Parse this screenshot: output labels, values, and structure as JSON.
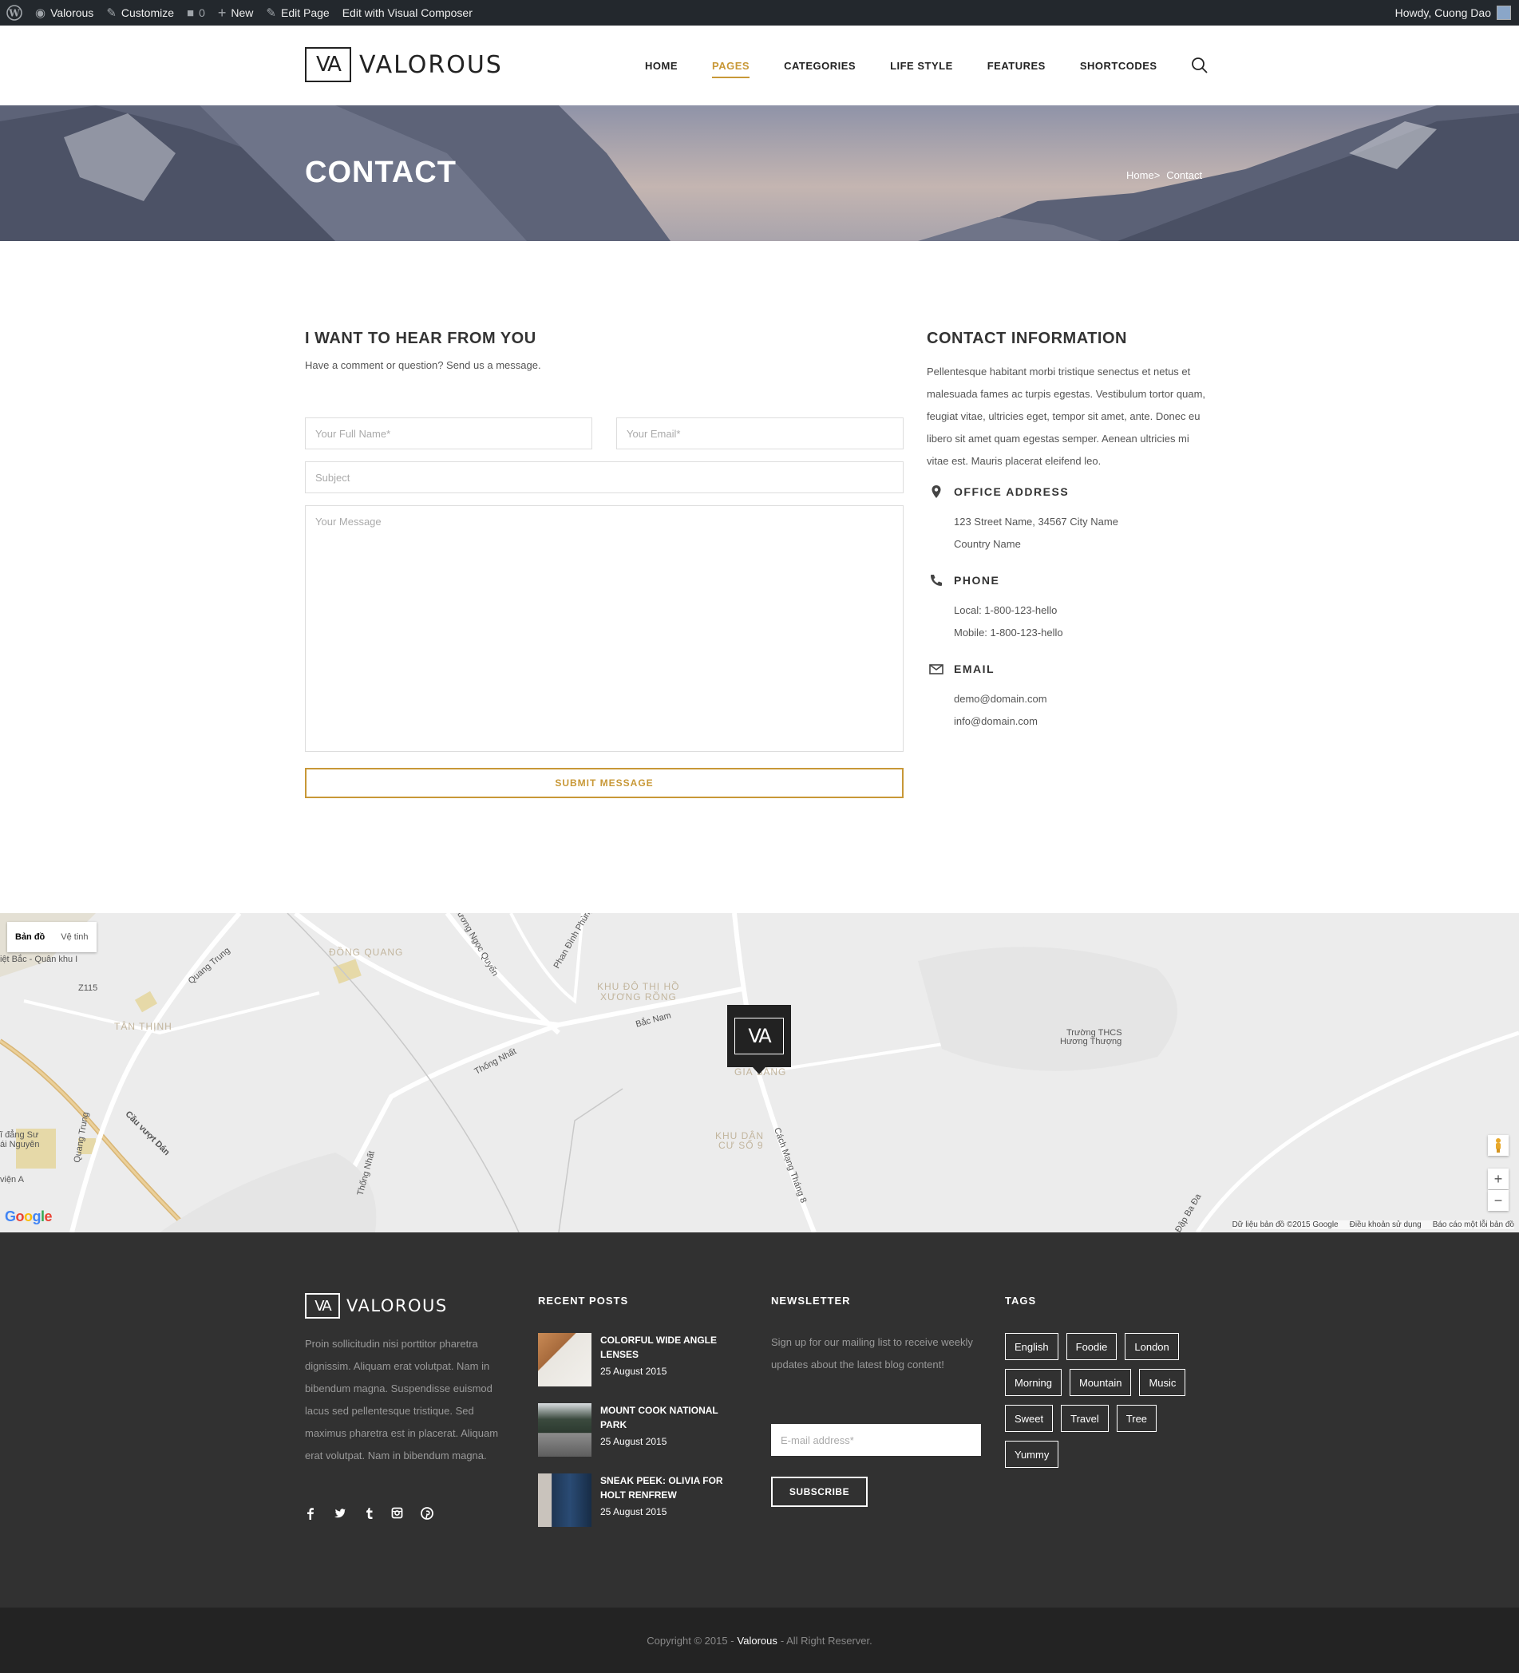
{
  "admin_bar": {
    "site": "Valorous",
    "customize": "Customize",
    "comments": "0",
    "new": "New",
    "edit_page": "Edit Page",
    "visual_composer": "Edit with Visual Composer",
    "howdy": "Howdy, Cuong Dao"
  },
  "header": {
    "logo_mark": "VA",
    "logo_text": "VALOROUS",
    "nav": [
      "HOME",
      "PAGES",
      "CATEGORIES",
      "LIFE STYLE",
      "FEATURES",
      "SHORTCODES"
    ],
    "active_nav": "PAGES"
  },
  "hero": {
    "title": "CONTACT",
    "breadcrumb": [
      "Home",
      ">",
      "Contact"
    ]
  },
  "form": {
    "title": "I WANT TO HEAR FROM YOU",
    "subtitle": "Have a comment or question? Send us a message.",
    "name_placeholder": "Your Full Name*",
    "email_placeholder": "Your Email*",
    "subject_placeholder": "Subject",
    "message_placeholder": "Your Message",
    "submit": "SUBMIT MESSAGE"
  },
  "contact_info": {
    "title": "CONTACT INFORMATION",
    "text": "Pellentesque habitant morbi tristique senectus et netus et malesuada fames ac turpis egestas. Vestibulum tortor quam, feugiat vitae, ultricies eget, tempor sit amet, ante. Donec eu libero sit amet quam egestas semper. Aenean ultricies mi vitae est. Mauris placerat eleifend leo.",
    "office_title": "OFFICE ADDRESS",
    "office_lines": [
      "123 Street Name, 34567 City Name",
      "Country Name"
    ],
    "phone_title": "PHONE",
    "phone_lines": [
      "Local: 1-800-123-hello",
      "Mobile: 1-800-123-hello"
    ],
    "email_title": "EMAIL",
    "email_lines": [
      "demo@domain.com",
      "info@domain.com"
    ]
  },
  "map": {
    "map_type": "Bản đồ",
    "satellite": "Vệ tinh",
    "labels": {
      "dong_quang": "ĐỒNG QUANG",
      "tan_thinh": "TÂN THỊNH",
      "khu_do_thi": "KHU ĐÔ THỊ HỒ",
      "xuong_rong": "XƯƠNG RỒNG",
      "khu_dan": "KHU DÂN",
      "cu_so": "CƯ SỐ 9",
      "gia_sang": "GIA SÀNG",
      "quang_trung": "Quang Trung",
      "bac_nam": "Bắc Nam",
      "thong_nhat": "Thống Nhất",
      "thong_nhat2": "Thống Nhất",
      "cau_vuot": "Cầu vượt Dán",
      "z115": "Z115",
      "phan_dinh_phung": "Phan Đình Phùng",
      "luong_ngoc_quyen": "Lương Ngọc Quyến",
      "cach_mang": "Cách Mạng Tháng 8",
      "quan_khu": "iệt Bắc - Quân khu I",
      "school1": "Trường THCS",
      "school2": "Hương Thượng",
      "dang_su": "ĩ đẳng Sư",
      "nguyen": "ái Nguyên",
      "vien_a": "viện A",
      "ap_ba_da": "Đập Ba Đa"
    },
    "google": "Google",
    "footer_links": [
      "Dữ liệu bản đồ ©2015 Google",
      "Điều khoản sử dụng",
      "Báo cáo một lỗi bản đồ"
    ]
  },
  "footer": {
    "logo_mark": "VA",
    "logo_text": "VALOROUS",
    "about": "Proin sollicitudin nisi porttitor pharetra dignissim. Aliquam erat volutpat. Nam in bibendum magna. Suspendisse euismod lacus sed pellentesque tristique. Sed maximus pharetra est in placerat. Aliquam erat volutpat. Nam in bibendum magna.",
    "social_icons": [
      "facebook-icon",
      "twitter-icon",
      "tumblr-icon",
      "instagram-icon",
      "pinterest-icon"
    ],
    "recent_title": "RECENT POSTS",
    "posts": [
      {
        "title": "COLORFUL WIDE ANGLE LENSES",
        "date": "25 August 2015"
      },
      {
        "title": "MOUNT COOK NATIONAL PARK",
        "date": "25 August 2015"
      },
      {
        "title": "SNEAK PEEK: OLIVIA FOR HOLT RENFREW",
        "date": "25 August 2015"
      }
    ],
    "newsletter_title": "NEWSLETTER",
    "newsletter_text": "Sign up for our mailing list to receive weekly updates about the latest blog content!",
    "newsletter_placeholder": "E-mail address*",
    "subscribe": "SUBSCRIBE",
    "tags_title": "TAGS",
    "tags": [
      "English",
      "Foodie",
      "London",
      "Morning",
      "Mountain",
      "Music",
      "Sweet",
      "Travel",
      "Tree",
      "Yummy"
    ]
  },
  "copyright": {
    "prefix": "Copyright © 2015 -",
    "brand": "Valorous",
    "suffix": "- All Right Reserver."
  }
}
